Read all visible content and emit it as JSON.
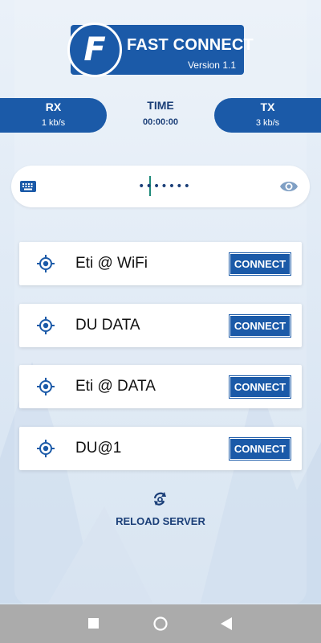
{
  "brand": {
    "title": "FAST CONNECT",
    "version": "Version 1.1",
    "logo_letter": "F"
  },
  "stats": {
    "rx": {
      "label": "RX",
      "value": "1 kb/s"
    },
    "time": {
      "label": "TIME",
      "value": "00:00:00"
    },
    "tx": {
      "label": "TX",
      "value": "3 kb/s"
    }
  },
  "password": {
    "value": "•••••••",
    "keyboard_icon": "keyboard-icon",
    "toggle_icon": "eye-icon"
  },
  "servers": [
    {
      "name": "Eti @ WiFi",
      "button": "CONNECT"
    },
    {
      "name": "DU DATA",
      "button": "CONNECT"
    },
    {
      "name": "Eti @ DATA",
      "button": "CONNECT"
    },
    {
      "name": "DU@1",
      "button": "CONNECT"
    }
  ],
  "reload": {
    "label": "RELOAD SERVER",
    "icon": "refresh-search-icon"
  },
  "colors": {
    "primary": "#1b5aa8",
    "text_dark": "#1b3f78",
    "background": "#e3ecf6"
  }
}
